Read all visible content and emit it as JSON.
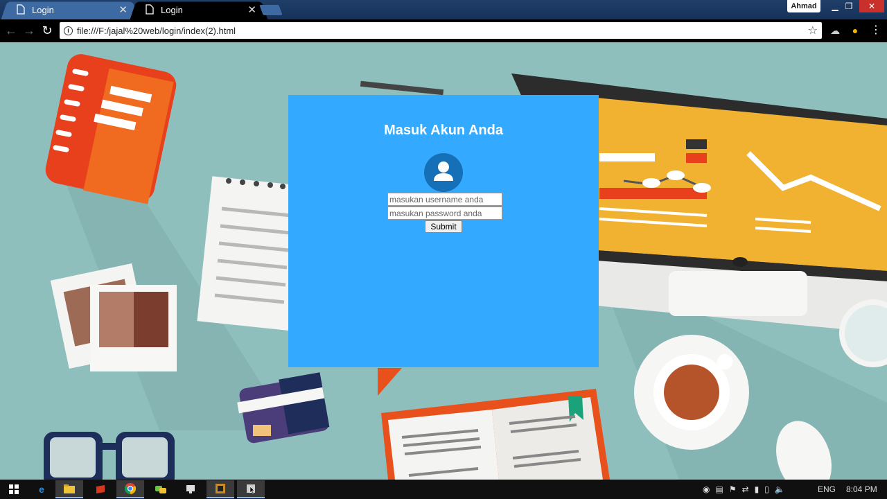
{
  "browser": {
    "tabs": [
      {
        "title": "Login",
        "state": "inactive"
      },
      {
        "title": "Login",
        "state": "active"
      }
    ],
    "user_chip": "Ahmad",
    "url": "file:///F:/jajal%20web/login/index(2).html"
  },
  "login": {
    "heading": "Masuk Akun Anda",
    "username_placeholder": "masukan username anda",
    "password_placeholder": "masukan password anda",
    "submit_label": "Submit"
  },
  "taskbar": {
    "language": "ENG",
    "time": "8:04 PM"
  },
  "colors": {
    "panel": "#33aaff",
    "avatar": "#1570b8",
    "background": "#8fbfbd"
  }
}
